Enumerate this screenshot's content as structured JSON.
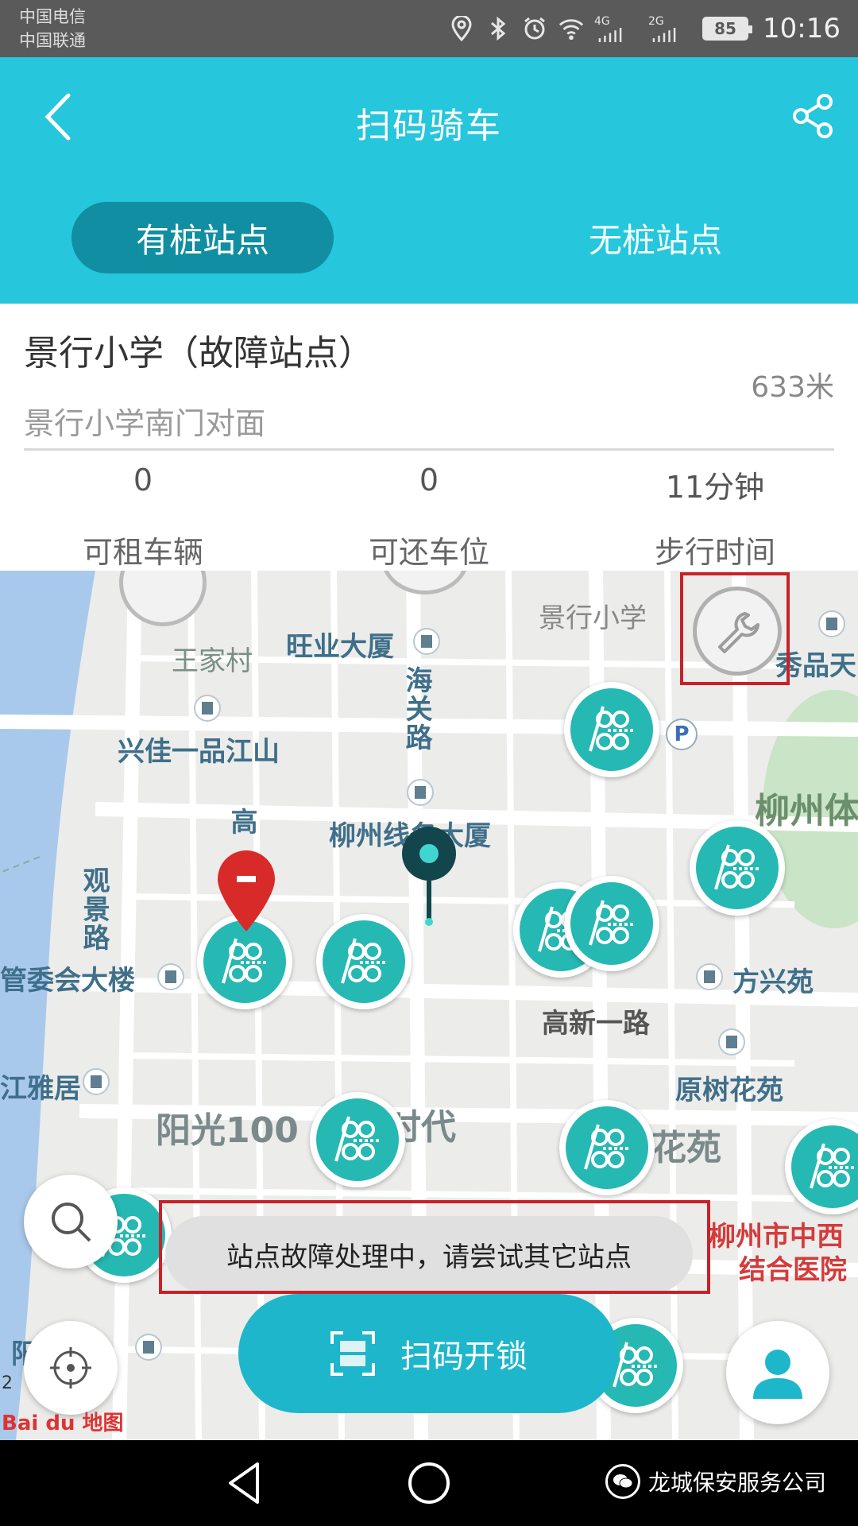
{
  "status_bar": {
    "carrier_1": "中国电信",
    "carrier_2": "中国联通",
    "signal_4g": "4G",
    "signal_2g": "2G",
    "battery": "85",
    "time": "10:16",
    "icons": [
      "location-icon",
      "bluetooth-icon",
      "alarm-icon",
      "wifi-icon"
    ]
  },
  "header": {
    "title": "扫码骑车",
    "back_icon": "back-arrow-icon",
    "share_icon": "share-icon",
    "tabs": [
      {
        "label": "有桩站点",
        "active": true
      },
      {
        "label": "无桩站点",
        "active": false
      }
    ]
  },
  "station": {
    "name": "景行小学（故障站点）",
    "address": "景行小学南门对面",
    "distance": "633米",
    "stats": [
      {
        "value": "0",
        "label": "可租车辆"
      },
      {
        "value": "0",
        "label": "可还车位"
      },
      {
        "value": "11分钟",
        "label": "步行时间"
      }
    ]
  },
  "map": {
    "labels": {
      "jingxing": "景行小学",
      "wangjiacun": "王家村",
      "wangye": "旺业大厦",
      "haiguan": "海关路",
      "xiujia": "兴佳一品江山",
      "liuzhou_xianfu": "柳州线务大厦",
      "gao": "高",
      "guanjing": "观景路",
      "guanwei": "管委会大楼",
      "jiangya": "江雅居",
      "yangguang": "阳光100",
      "shidai": "时代",
      "gaoxin": "高新一路",
      "fangxing": "方兴苑",
      "yuanshu": "原树花苑",
      "huayuan": "花苑",
      "liuzhou_ti": "柳州体",
      "xiupin": "秀品天",
      "hospital_1": "柳州市中西",
      "hospital_2": "结合医院",
      "yang2": "阳",
      "parking": "P"
    },
    "toast": "站点故障处理中，请尝试其它站点",
    "scan_button": "扫码开锁",
    "baidu": "Bai du 地图",
    "scale": "2"
  },
  "colors": {
    "accent": "#26c6dc",
    "tab_active": "#118ea1",
    "station_green": "#26b8b3",
    "highlight": "#c8212a"
  },
  "nav": {
    "watermark": "龙城保安服务公司"
  }
}
